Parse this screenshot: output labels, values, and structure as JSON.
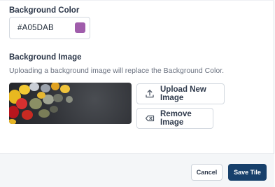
{
  "background_color": {
    "label": "Background Color",
    "value": "#A05DAB",
    "swatch": "#A05DAB"
  },
  "background_image": {
    "label": "Background Image",
    "help": "Uploading a background image will replace the Background Color.",
    "preview_icon": "image-preview",
    "upload_label": "Upload New Image",
    "upload_icon": "upload-icon",
    "remove_label": "Remove Image",
    "remove_icon": "backspace-icon"
  },
  "footer": {
    "cancel_label": "Cancel",
    "save_label": "Save Tile",
    "save_color": "#17406B"
  }
}
